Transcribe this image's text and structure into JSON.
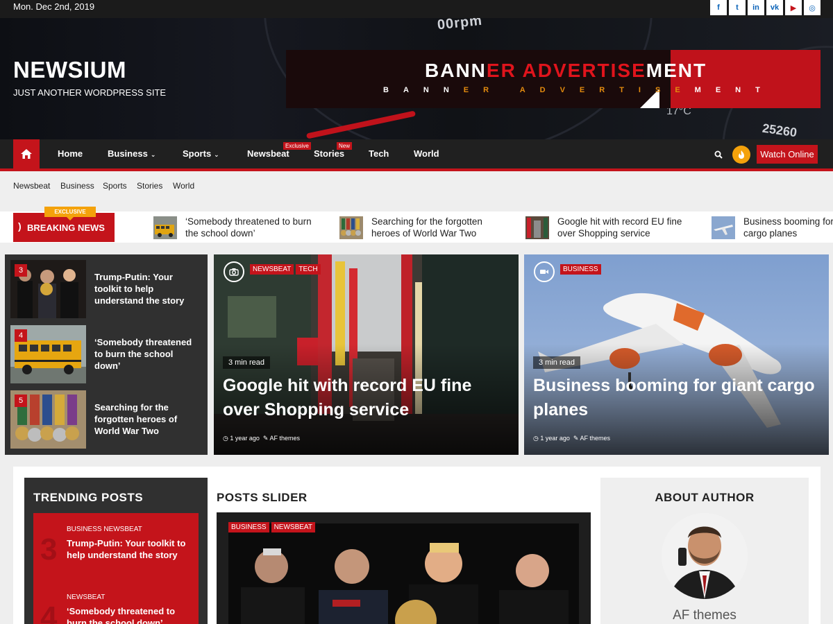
{
  "topbar": {
    "date": "Mon. Dec 2nd, 2019",
    "social": [
      {
        "icon": "facebook-icon",
        "glyph": "f"
      },
      {
        "icon": "twitter-icon",
        "glyph": "t"
      },
      {
        "icon": "linkedin-icon",
        "glyph": "in"
      },
      {
        "icon": "vk-icon",
        "glyph": "vk"
      },
      {
        "icon": "youtube-icon",
        "glyph": "▶"
      },
      {
        "icon": "instagram-icon",
        "glyph": "◎"
      }
    ]
  },
  "header": {
    "site_title": "NEWSIUM",
    "site_description": "JUST ANOTHER WORDPRESS SITE",
    "banner": {
      "big_a": "BANN",
      "big_b": "ER ADVERTISE",
      "big_c": "MENT",
      "small_a": "BANN",
      "small_b": "ER ADVERTISE",
      "small_c": "MENT"
    },
    "dash_rpm": "00rpm",
    "dash_odo": "25260",
    "dash_temp": "17°C"
  },
  "nav": {
    "items": [
      {
        "label": "Home"
      },
      {
        "label": "Business",
        "caret": "⌄"
      },
      {
        "label": "Sports",
        "caret": "⌄"
      },
      {
        "label": "Newsbeat",
        "badge": "Exclusive"
      },
      {
        "label": "Stories",
        "badge": "New"
      },
      {
        "label": "Tech"
      },
      {
        "label": "World"
      }
    ],
    "watch_label": "Watch Online"
  },
  "subnav": [
    "Newsbeat",
    "Business",
    "Sports",
    "Stories",
    "World"
  ],
  "breaking": {
    "exclusive": "EXCLUSIVE",
    "label": "BREAKING NEWS",
    "items": [
      "‘Somebody threatened to burn the school down’",
      "Searching for the forgotten heroes of World War Two",
      "Google hit with record EU fine over Shopping service",
      "Business booming for giant cargo planes"
    ]
  },
  "left_list": [
    {
      "num": "3",
      "title": "Trump-Putin: Your toolkit to help understand the story"
    },
    {
      "num": "4",
      "title": "‘Somebody threatened to burn the school down’"
    },
    {
      "num": "5",
      "title": "Searching for the forgotten heroes of World War Two"
    }
  ],
  "features": [
    {
      "cats": [
        "NEWSBEAT",
        "TECH"
      ],
      "read": "3 min read",
      "title": "Google hit with record EU fine over Shopping service",
      "time": "1 year ago",
      "author": "AF themes",
      "icon": "camera-icon"
    },
    {
      "cats": [
        "BUSINESS"
      ],
      "read": "3 min read",
      "title": "Business booming for giant cargo planes",
      "time": "1 year ago",
      "author": "AF themes",
      "icon": "video-icon"
    }
  ],
  "trending": {
    "heading": "TRENDING POSTS",
    "posts": [
      {
        "num": "3",
        "cats": "BUSINESS   NEWSBEAT",
        "title": "Trump-Putin: Your toolkit to help understand the story"
      },
      {
        "num": "4",
        "cats": "NEWSBEAT",
        "title": "‘Somebody threatened to burn the school down’"
      }
    ]
  },
  "slider": {
    "heading": "POSTS SLIDER",
    "cats": [
      "BUSINESS",
      "NEWSBEAT"
    ]
  },
  "about": {
    "heading": "ABOUT AUTHOR",
    "name": "AF themes"
  },
  "colors": {
    "accent": "#c4141b",
    "dark": "#303030",
    "orange": "#f4a20b"
  }
}
